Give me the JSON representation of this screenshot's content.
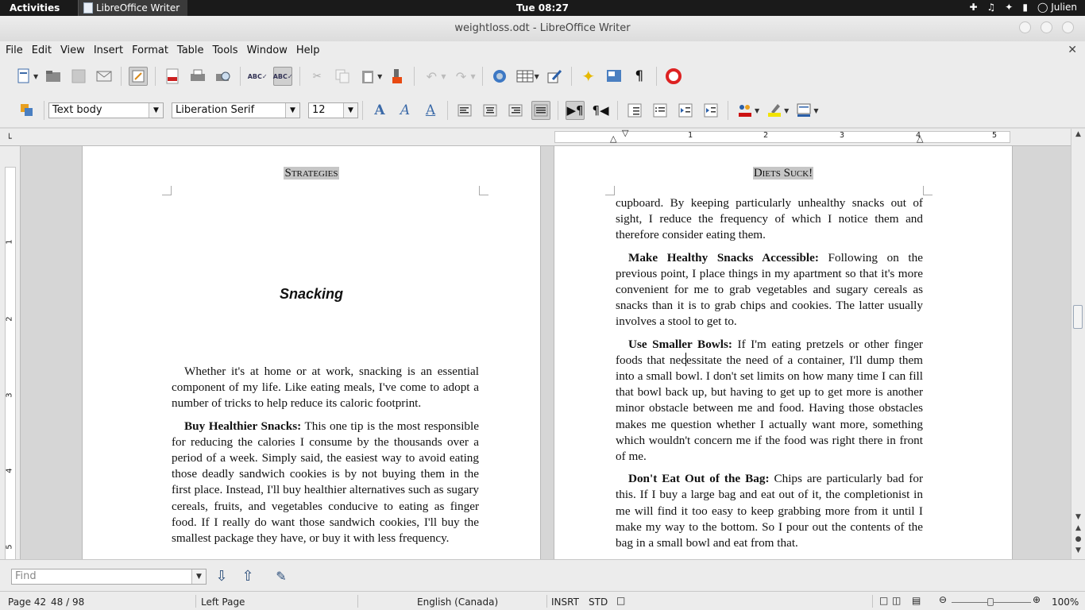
{
  "topbar": {
    "activities": "Activities",
    "app_name": "LibreOffice Writer",
    "clock": "Tue 08:27",
    "user": "Julien"
  },
  "window": {
    "title": "weightloss.odt - LibreOffice Writer"
  },
  "menu": [
    "File",
    "Edit",
    "View",
    "Insert",
    "Format",
    "Table",
    "Tools",
    "Window",
    "Help"
  ],
  "formatting": {
    "paragraph_style": "Text body",
    "font_name": "Liberation Serif",
    "font_size": "12"
  },
  "document": {
    "left_page": {
      "header": "Strategies",
      "heading": "Snacking",
      "paragraphs": [
        {
          "bold": "",
          "text": "Whether it's at home or at work, snacking is an essential component of my life. Like eating meals, I've come to adopt a number of tricks to help reduce its caloric footprint."
        },
        {
          "bold": "Buy Healthier Snacks:",
          "text": " This one tip is the most responsible for reducing the calories I consume by the thousands over a period of a week. Simply said, the easiest way to avoid eating those deadly sandwich cookies is by not buying them in the first place. Instead, I'll buy healthier alternatives such as sugary cereals, fruits, and vegetables conducive to eating as finger food. If I really do want those sandwich cookies, I'll buy the smallest package they have, or buy it with less frequency."
        }
      ]
    },
    "right_page": {
      "header": "Diets Suck!",
      "continuation": "cupboard. By keeping particularly unhealthy snacks out of sight, I reduce the frequency of which I notice them and therefore consider eating them.",
      "paragraphs": [
        {
          "bold": "Make Healthy Snacks Accessible:",
          "text": " Following on the previous point, I place things in my apartment so that it's more convenient for me to grab vegetables and sugary cereals as snacks than it is to grab chips and cookies. The latter usually involves a stool to get to."
        },
        {
          "bold": "Use Smaller Bowls:",
          "text_before_caret": " If I'm eating pretzels or other finger foods that nec",
          "text_after_caret": "essitate the need of a container, I'll dump them into a small bowl. I don't set limits on how many time I can fill that bowl back up, but having to get up to get more is another minor obstacle between me and food. Having those obstacles makes me question whether I actually want more, something which wouldn't concern me if the food was right there in front of me."
        },
        {
          "bold": "Don't Eat Out of the Bag:",
          "text": " Chips are particularly bad for this. If I buy a large bag and eat out of it, the completionist in me will find it too easy to keep grabbing more from it until I make my way to the bottom. So I pour out the contents of the bag in a small bowl and eat from that."
        }
      ]
    }
  },
  "ruler": {
    "h_numbers": [
      "1",
      "2",
      "3",
      "4",
      "5"
    ],
    "v_numbers": [
      "1",
      "2",
      "3",
      "4",
      "5"
    ]
  },
  "find": {
    "placeholder": "Find"
  },
  "status": {
    "page": "Page 42",
    "page_count": "48 / 98",
    "page_style": "Left Page",
    "language": "English (Canada)",
    "insert_mode": "INSRT",
    "selection_mode": "STD",
    "zoom": "100%"
  }
}
